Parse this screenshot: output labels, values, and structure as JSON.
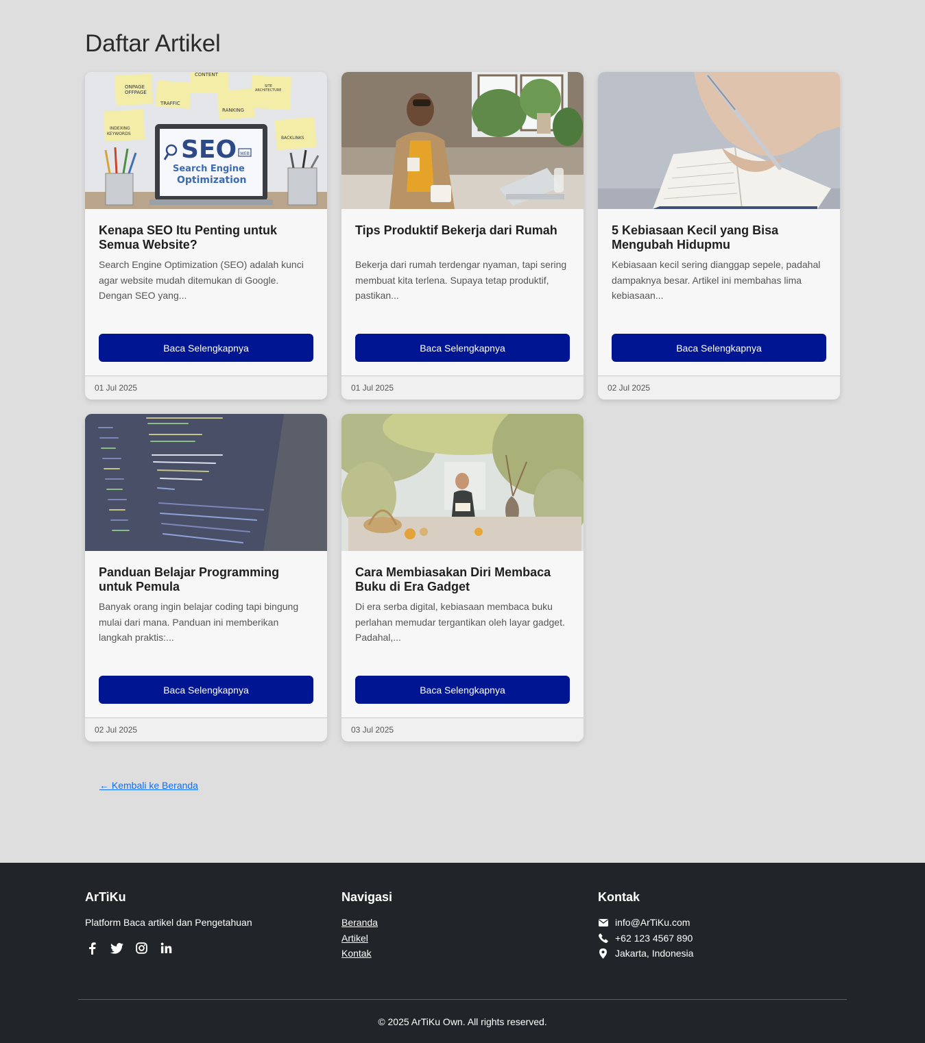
{
  "page": {
    "title": "Daftar Artikel"
  },
  "articles": [
    {
      "title": "Kenapa SEO Itu Penting untuk Semua Website?",
      "excerpt": "Search Engine Optimization (SEO) adalah kunci agar website mudah ditemukan di Google. Dengan SEO yang...",
      "button": "Baca Selengkapnya",
      "date": "01 Jul 2025",
      "image": "seo-laptop-sticky-notes",
      "image_text": {
        "seo": "SEO",
        "line1": "Search Engine",
        "line2": "Optimization",
        "web": "WEB",
        "notes": [
          "ONPAGE",
          "OFFPAGE",
          "CONTENT",
          "SITE",
          "ARCHITECTURE",
          "TRAFFIC",
          "RANKING",
          "INDEXING",
          "KEYWORDS",
          "BACKLINKS"
        ]
      }
    },
    {
      "title": "Tips Produktif Bekerja dari Rumah",
      "excerpt": "Bekerja dari rumah terdengar nyaman, tapi sering membuat kita terlena. Supaya tetap produktif, pastikan...",
      "button": "Baca Selengkapnya",
      "date": "01 Jul 2025",
      "image": "man-working-at-desk"
    },
    {
      "title": "5 Kebiasaan Kecil yang Bisa Mengubah Hidupmu",
      "excerpt": "Kebiasaan kecil sering dianggap sepele, padahal dampaknya besar. Artikel ini membahas lima kebiasaan...",
      "button": "Baca Selengkapnya",
      "date": "02 Jul 2025",
      "image": "hand-writing-in-notebook"
    },
    {
      "title": "Panduan Belajar Programming untuk Pemula",
      "excerpt": "Banyak orang ingin belajar coding tapi bingung mulai dari mana. Panduan ini memberikan langkah praktis:...",
      "button": "Baca Selengkapnya",
      "date": "02 Jul 2025",
      "image": "code-on-monitor"
    },
    {
      "title": "Cara Membiasakan Diri Membaca Buku di Era Gadget",
      "excerpt": "Di era serba digital, kebiasaan membaca buku perlahan memudar tergantikan oleh layar gadget. Padahal,...",
      "button": "Baca Selengkapnya",
      "date": "03 Jul 2025",
      "image": "woman-reading-in-garden"
    }
  ],
  "back_link": "← Kembali ke Beranda",
  "footer": {
    "brand": "ArTiKu",
    "tagline": "Platform Baca artikel dan Pengetahuan",
    "social": [
      "facebook-icon",
      "twitter-icon",
      "instagram-icon",
      "linkedin-icon"
    ],
    "nav_title": "Navigasi",
    "nav": [
      "Beranda",
      "Artikel",
      "Kontak"
    ],
    "contact_title": "Kontak",
    "email": "info@ArTiKu.com",
    "phone": "+62 123 4567 890",
    "location": "Jakarta, Indonesia",
    "copyright": "© 2025 ArTiKu Own. All rights reserved."
  },
  "colors": {
    "background": "#dedede",
    "button": "#001591",
    "footer": "#212529",
    "link": "#0d6efd"
  }
}
